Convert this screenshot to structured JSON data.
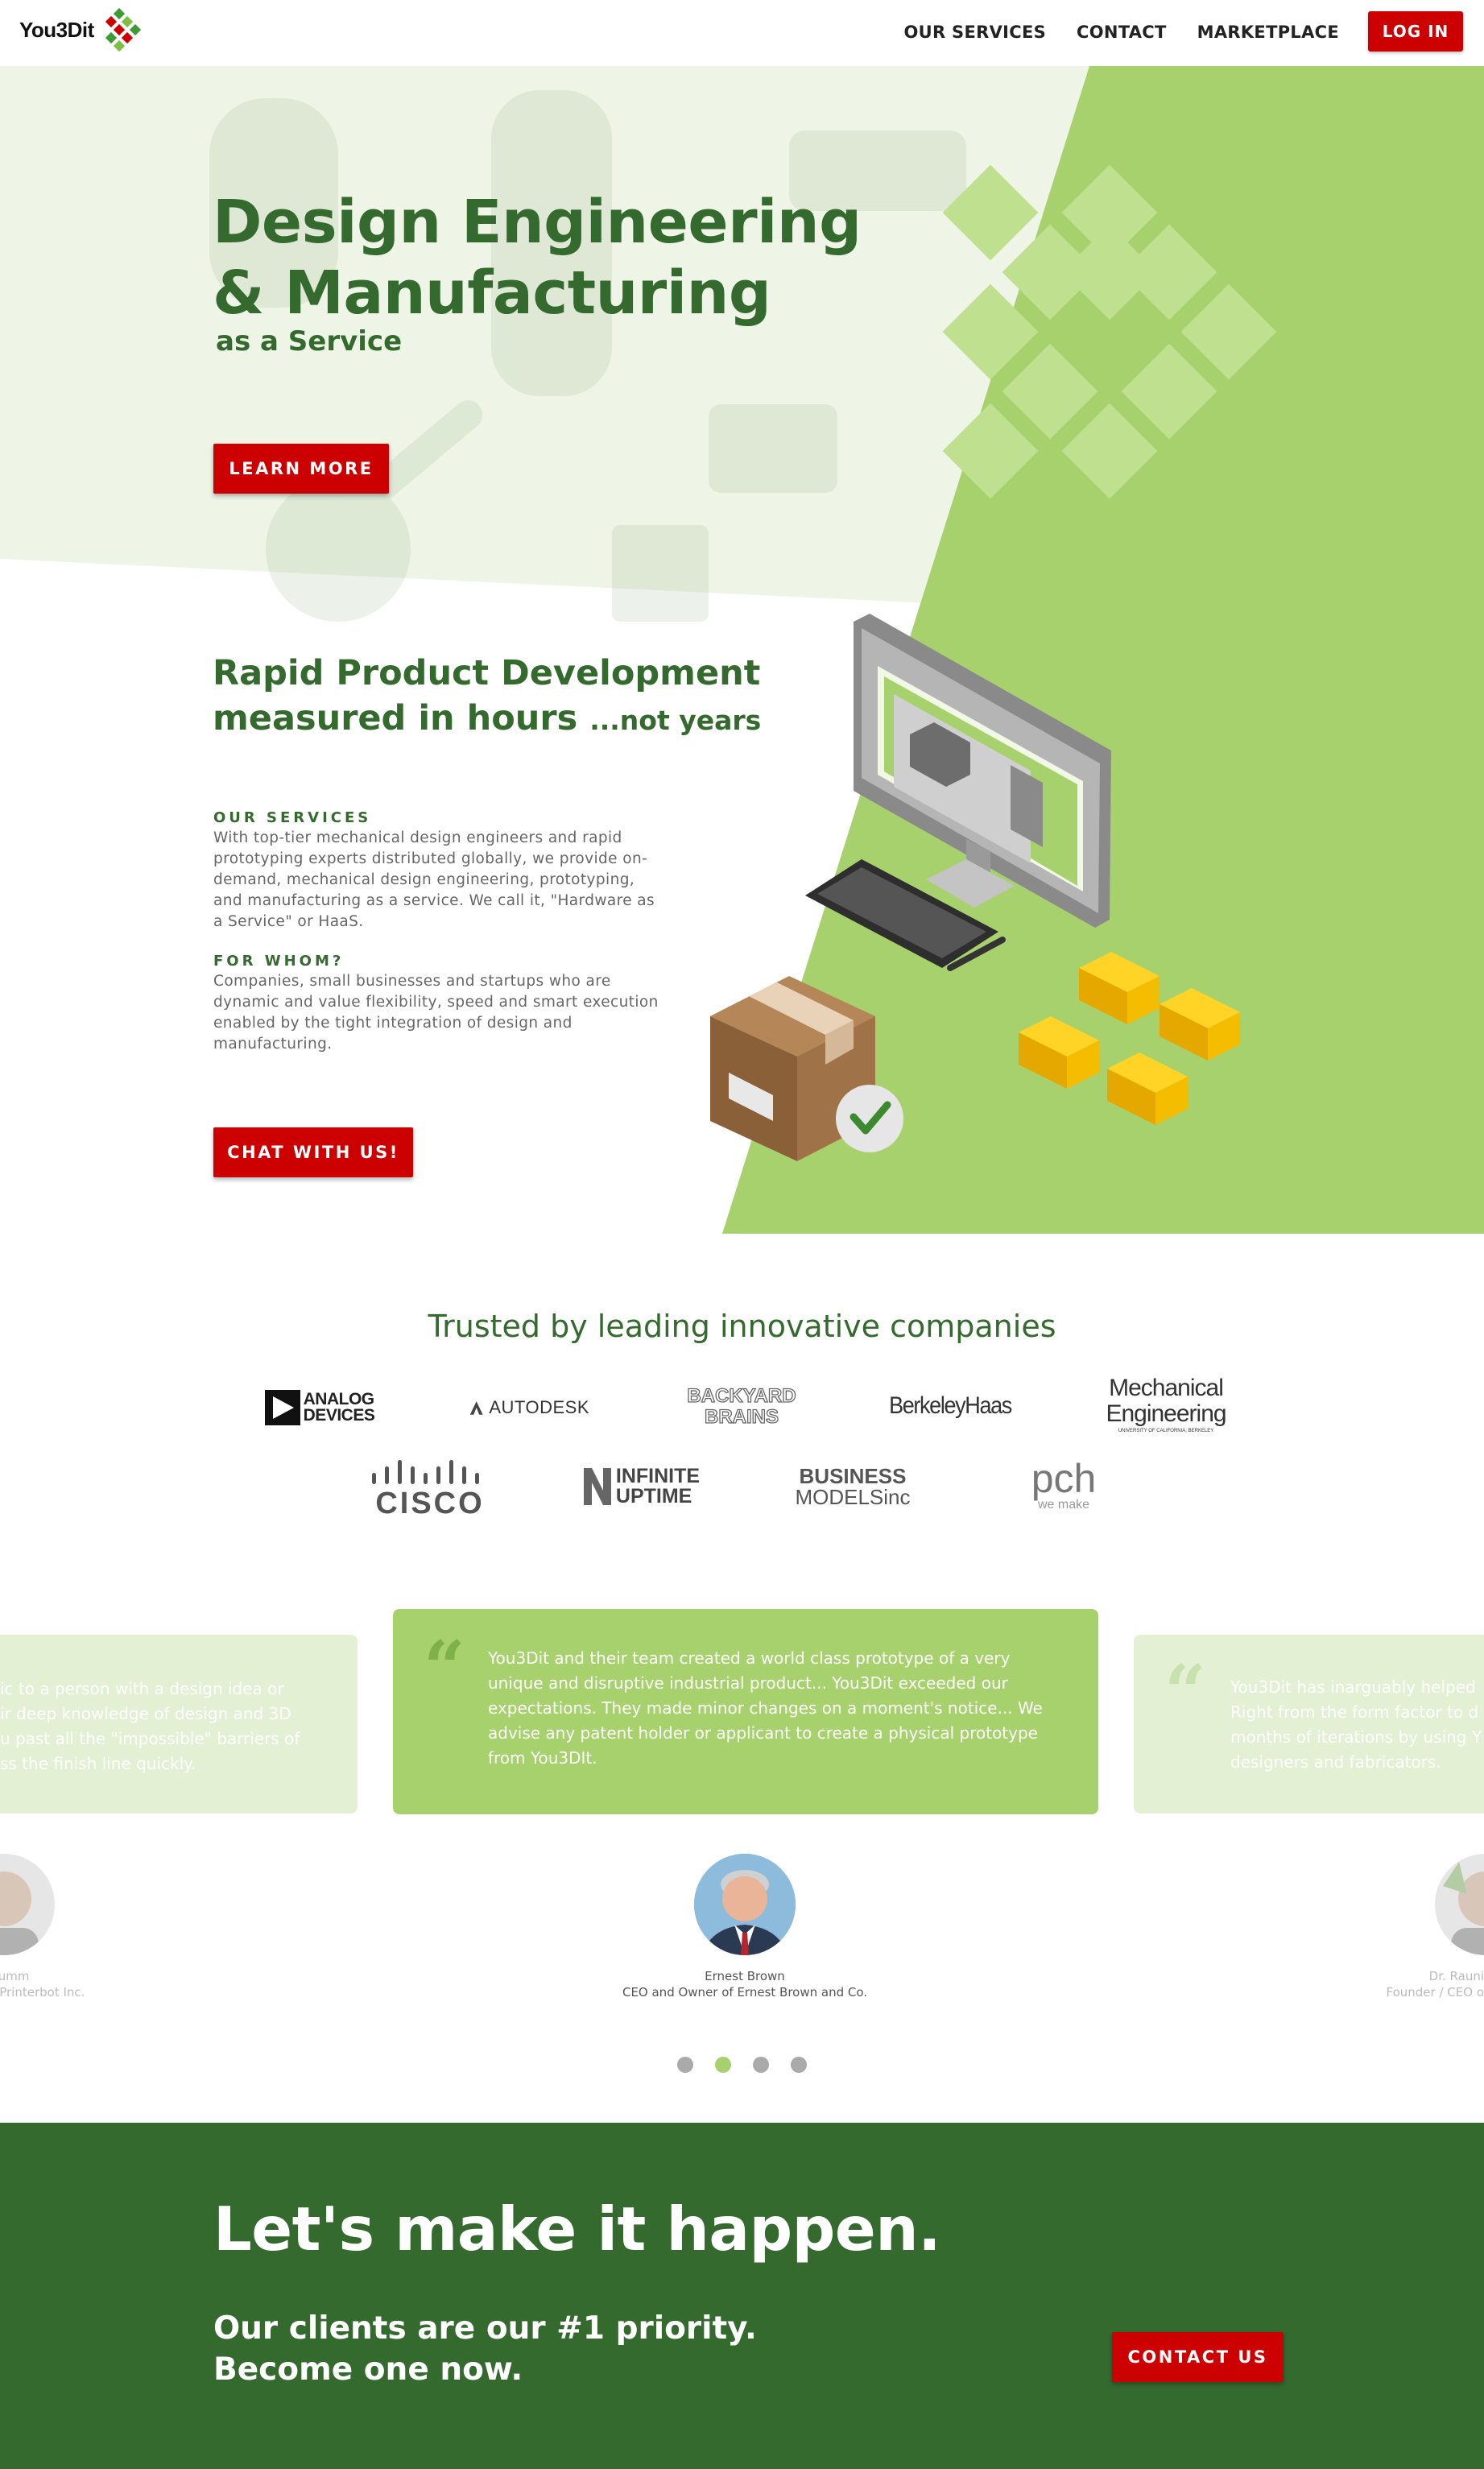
{
  "nav": {
    "brand": "You3Dit",
    "links": [
      "OUR SERVICES",
      "CONTACT",
      "MARKETPLACE"
    ],
    "login": "LOG IN"
  },
  "hero": {
    "title_line1": "Design Engineering",
    "title_line2": "& Manufacturing",
    "subtitle": "as a Service",
    "button": "LEARN MORE"
  },
  "intro": {
    "title_line1": "Rapid Product Development",
    "title_line2_main": "measured in hours",
    "title_line2_small": "...not years",
    "services_heading": "OUR SERVICES",
    "services_text": "With top-tier mechanical design engineers and rapid prototyping experts distributed globally, we provide on-demand, mechanical design engineering, prototyping, and manufacturing as a service. We call it, \"Hardware as a Service\" or HaaS.",
    "whom_heading": "FOR WHOM?",
    "whom_text": "Companies, small businesses and startups who are dynamic and value flexibility, speed and smart execution enabled by the tight integration of design and manufacturing.",
    "button": "CHAT WITH US!"
  },
  "trusted": {
    "heading": "Trusted by leading innovative companies",
    "logos": {
      "analog_line1": "ANALOG",
      "analog_line2": "DEVICES",
      "autodesk": "AUTODESK",
      "backyard_line1": "BACKYARD",
      "backyard_line2": "BRAINS",
      "berkeley": "BerkeleyHaas",
      "mech_line1": "Mechanical",
      "mech_line2": "Engineering",
      "mech_line3": "UNIVERSITY OF CALIFORNIA, BERKELEY",
      "cisco": "CISCO",
      "infinite_line1": "INFINITE",
      "infinite_line2": "UPTIME",
      "business_line1": "BUSINESS",
      "business_line2": "MODELSinc",
      "pch": "pch",
      "pch_tag": "we make"
    }
  },
  "testimonials": {
    "left_text": "ic to a person with a design idea or\nir deep knowledge of design and 3D\nu past all the \"impossible\" barriers of\nss the finish line quickly.",
    "center_text": "You3Dit and their team created a world class prototype of a very unique and disruptive industrial product... You3Dit exceeded our expectations. They made minor changes on a moment's notice... We advise any patent holder or applicant to create a physical prototype from You3DIt.",
    "right_text": "You3Dit has inarguably helped\nRight from the form factor to d\nmonths of iterations by using Y\ndesigners and fabricators.",
    "left_person_name": "Drumm",
    "left_person_role": "of Printerbot Inc.",
    "center_person_name": "Ernest Brown",
    "center_person_role": "CEO and Owner of Ernest Brown and Co.",
    "right_person_name": "Dr. Rauni",
    "right_person_role": "Founder / CEO o",
    "active_dot": 2
  },
  "cta": {
    "title": "Let's make it happen.",
    "line1": "Our clients are our #1 priority.",
    "line2": "Become one now.",
    "button": "CONTACT US"
  },
  "colors": {
    "brand_green": "#356a2f",
    "light_green": "#a6d16d",
    "red": "#cc0000"
  }
}
